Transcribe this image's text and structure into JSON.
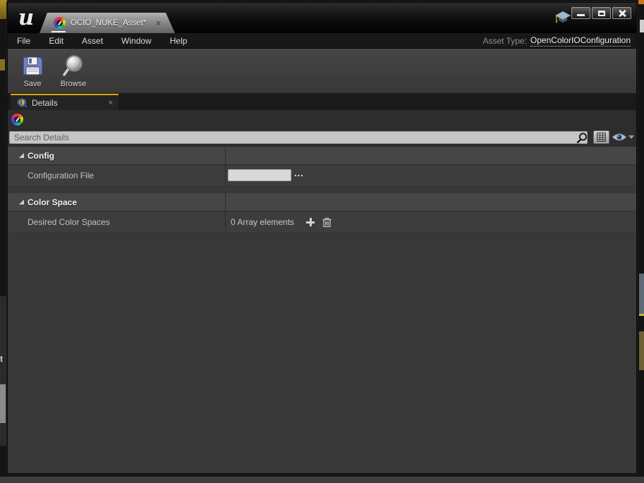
{
  "window": {
    "tab": {
      "label": "OCIO_NUKE_Asset*",
      "close_glyph": "×"
    },
    "controls": {
      "minimize": "minimize",
      "maximize": "maximize",
      "close": "close"
    }
  },
  "menu": {
    "items": [
      "File",
      "Edit",
      "Asset",
      "Window",
      "Help"
    ],
    "asset_type": {
      "label": "Asset Type:",
      "value": "OpenColorIOConfiguration"
    }
  },
  "toolbar": {
    "save_label": "Save",
    "browse_label": "Browse"
  },
  "details": {
    "tab_label": "Details",
    "tab_close_glyph": "×",
    "search_placeholder": "Search Details"
  },
  "properties": {
    "sections": [
      {
        "title": "Config",
        "rows": [
          {
            "name": "Configuration File",
            "value": "",
            "browse_label": "..."
          }
        ]
      },
      {
        "title": "Color Space",
        "rows": [
          {
            "name": "Desired Color Spaces",
            "value": "0 Array elements"
          }
        ]
      }
    ]
  },
  "background_fragments": {
    "partial_text": "t"
  },
  "icons": {
    "logo": "unreal-engine-logo",
    "asset_tab_icon": "ocio-color-wheel-icon",
    "titlebar_right": "tutorial-graduation-cap-icon",
    "details_tab_icon": "details-info-magnifier-icon",
    "toolbar": [
      "save-floppy-icon",
      "browse-magnifier-icon"
    ],
    "search_row": [
      "search-icon",
      "grid-view-icon",
      "eye-visibility-icon",
      "chevron-down-icon"
    ],
    "array_row": [
      "plus-icon",
      "trash-icon"
    ]
  },
  "colors": {
    "active_tab_highlight": "#D8A909",
    "panel_bg": "#383838",
    "row_bg": "#3D3D3D",
    "header_bg": "#464646",
    "search_field_bg": "#C6C6C6",
    "titlebar_bg": "#111111"
  }
}
